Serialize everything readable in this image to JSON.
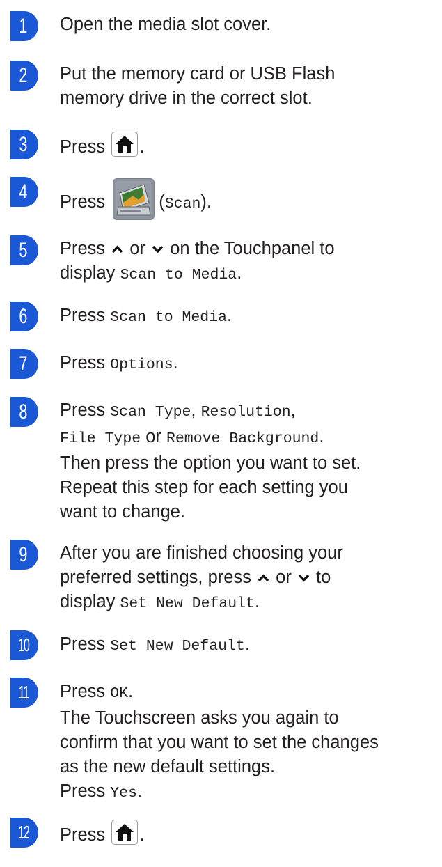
{
  "steps": [
    {
      "num": "1",
      "text": "Open the media slot cover."
    },
    {
      "num": "2",
      "line1": "Put the memory card or USB Flash",
      "line2": "memory drive in the correct slot."
    },
    {
      "num": "3",
      "press": "Press",
      "end": "."
    },
    {
      "num": "4",
      "press": "Press",
      "paren_open": "(",
      "scan": "Scan",
      "paren_close": ")."
    },
    {
      "num": "5",
      "press": "Press",
      "or": "or",
      "rest1": "on the Touchpanel to",
      "display": "display",
      "scan_to_media": "Scan to Media",
      "end": "."
    },
    {
      "num": "6",
      "press": "Press",
      "scan_to_media": "Scan to Media",
      "end": "."
    },
    {
      "num": "7",
      "press": "Press",
      "options": "Options",
      "end": "."
    },
    {
      "num": "8",
      "press": "Press",
      "scan_type": "Scan Type",
      "comma1": ",",
      "resolution": "Resolution",
      "comma2": ",",
      "file_type": "File Type",
      "or": "or",
      "remove_bg": "Remove Background",
      "end": ".",
      "line3": "Then press the option you want to set.",
      "line4": "Repeat this step for each setting you",
      "line5": "want to change."
    },
    {
      "num": "9",
      "line1": "After you are finished choosing your",
      "line2a": "preferred settings, press",
      "or": "or",
      "to": "to",
      "display": "display",
      "set_new_default": "Set New Default",
      "end": "."
    },
    {
      "num": "10",
      "press": "Press",
      "set_new_default": "Set New Default",
      "end": "."
    },
    {
      "num": "11",
      "press": "Press",
      "ok": "OK",
      "end": ".",
      "line2": "The Touchscreen asks you again to",
      "line3": "confirm that you want to set the changes",
      "line4": "as the new default settings.",
      "press2": "Press",
      "yes": "Yes",
      "end2": "."
    },
    {
      "num": "12",
      "press": "Press",
      "end": "."
    }
  ],
  "icons": {
    "step_marker": "numbered-step-marker",
    "home": "home-icon",
    "scan": "scanner-icon",
    "up": "chevron-up-icon",
    "down": "chevron-down-icon"
  },
  "colors": {
    "step_marker": "#1a58d6",
    "text": "#231f20"
  }
}
